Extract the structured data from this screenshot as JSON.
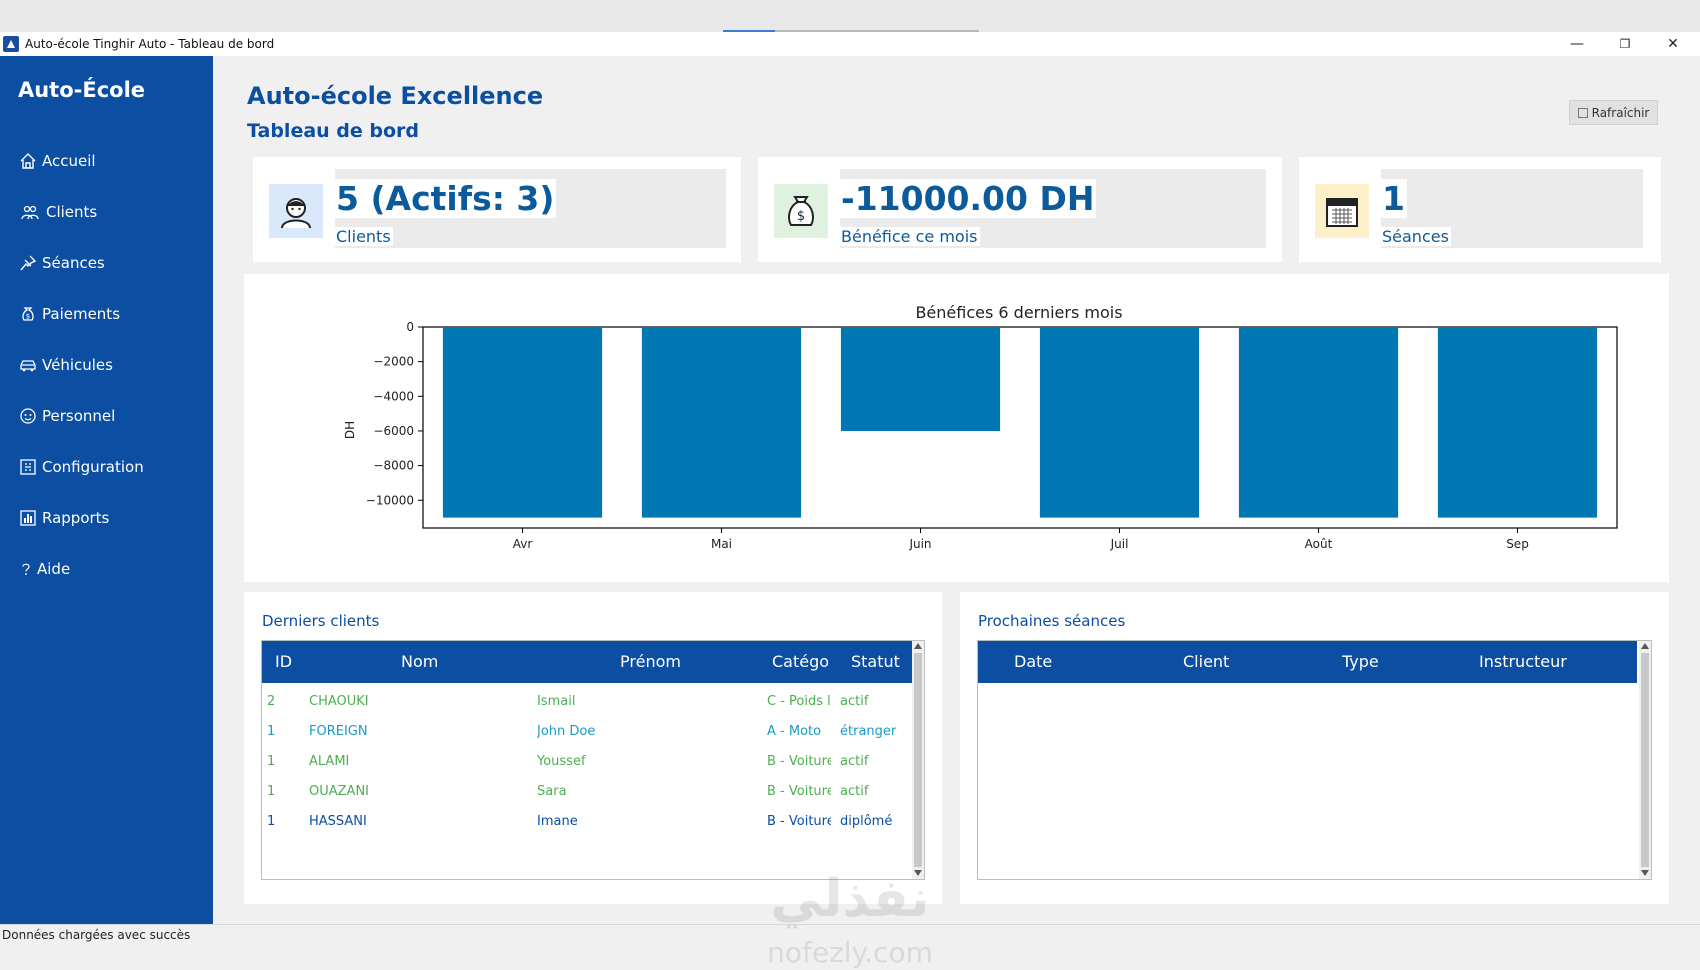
{
  "window": {
    "title": "Auto-école Tinghir Auto - Tableau de bord",
    "controls": [
      "—",
      "❐",
      "✕"
    ]
  },
  "sidebar": {
    "brand": "Auto-École",
    "items": [
      {
        "label": "Accueil",
        "icon": "home-icon"
      },
      {
        "label": "Clients",
        "icon": "users-icon"
      },
      {
        "label": "Séances",
        "icon": "pin-icon"
      },
      {
        "label": "Paiements",
        "icon": "money-icon"
      },
      {
        "label": "Véhicules",
        "icon": "car-icon"
      },
      {
        "label": "Personnel",
        "icon": "staff-icon"
      },
      {
        "label": "Configuration",
        "icon": "config-icon"
      },
      {
        "label": "Rapports",
        "icon": "chart-icon"
      },
      {
        "label": "Aide",
        "icon": "help-icon"
      }
    ],
    "color": "#0b4ea2"
  },
  "header": {
    "title": "Auto-école Excellence",
    "subtitle": "Tableau de bord",
    "refresh_label": "Rafraîchir"
  },
  "cards": [
    {
      "value": "5 (Actifs: 3)",
      "label": "Clients",
      "icon": "user-avatar-icon"
    },
    {
      "value": "-11000.00 DH",
      "label": "Bénéfice ce mois",
      "icon": "money-bag-icon"
    },
    {
      "value": "1",
      "label": "Séances",
      "icon": "calendar-icon"
    }
  ],
  "chart_data": {
    "type": "bar",
    "title": "Bénéfices 6 derniers mois",
    "xlabel": "",
    "ylabel": "DH",
    "categories": [
      "Avr",
      "Mai",
      "Juin",
      "Juil",
      "Août",
      "Sep"
    ],
    "values": [
      -11000,
      -11000,
      -6000,
      -11000,
      -11000,
      -11000
    ],
    "ylim": [
      -11600,
      0
    ],
    "yticks": [
      0,
      -2000,
      -4000,
      -6000,
      -8000,
      -10000
    ],
    "ytick_labels": [
      "0",
      "−2000",
      "−4000",
      "−6000",
      "−8000",
      "−10000"
    ],
    "bar_color": "#0077b3",
    "grid": false
  },
  "clients_panel": {
    "title": "Derniers clients",
    "columns": [
      "ID",
      "Nom",
      "Prénom",
      "Catégo",
      "Statut"
    ],
    "rows": [
      {
        "id": "2",
        "nom": "CHAOUKI",
        "prenom": "Ismail",
        "categorie": "C - Poids l",
        "statut": "actif",
        "color": "#4caf50"
      },
      {
        "id": "1",
        "nom": "FOREIGN",
        "prenom": "John Doe",
        "categorie": "A - Moto",
        "statut": "étranger",
        "color": "#1a9ac7"
      },
      {
        "id": "1",
        "nom": "ALAMI",
        "prenom": "Youssef",
        "categorie": "B - Voiture",
        "statut": "actif",
        "color": "#4caf50"
      },
      {
        "id": "1",
        "nom": "OUAZANI",
        "prenom": "Sara",
        "categorie": "B - Voiture",
        "statut": "actif",
        "color": "#4caf50"
      },
      {
        "id": "1",
        "nom": "HASSANI",
        "prenom": "Imane",
        "categorie": "B - Voiture",
        "statut": "diplômé",
        "color": "#0b4ea2"
      }
    ]
  },
  "sessions_panel": {
    "title": "Prochaines séances",
    "columns": [
      "Date",
      "Client",
      "Type",
      "Instructeur"
    ],
    "rows": []
  },
  "status": {
    "text": "Données chargées avec succès"
  },
  "watermark": {
    "arabic": "نفذلي",
    "latin": "nofezly.com"
  }
}
